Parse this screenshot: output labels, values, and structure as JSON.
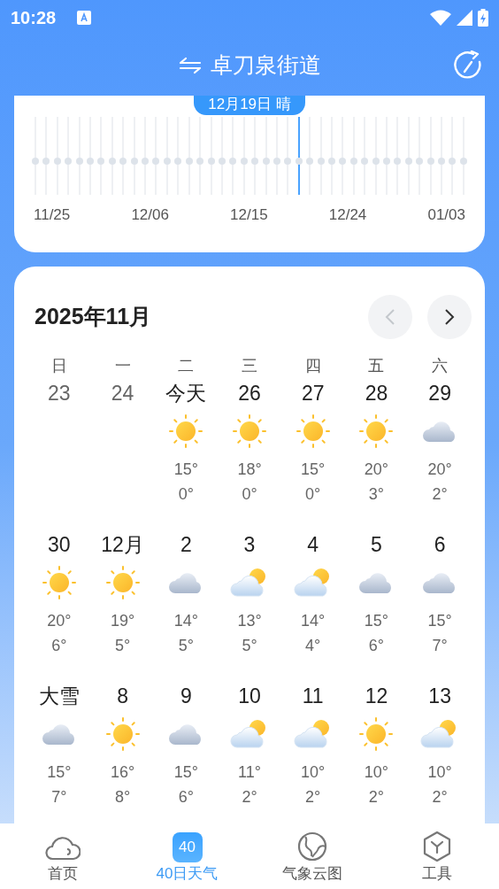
{
  "status_bar": {
    "time": "10:28"
  },
  "header": {
    "title": "卓刀泉街道"
  },
  "timeline": {
    "badge": "12月19日 晴",
    "days": [
      {
        "selected": false
      },
      {
        "selected": false
      },
      {
        "selected": false
      },
      {
        "selected": false
      },
      {
        "selected": false
      },
      {
        "selected": false
      },
      {
        "selected": false
      },
      {
        "selected": false
      },
      {
        "selected": false
      },
      {
        "selected": false
      },
      {
        "selected": false
      },
      {
        "selected": false
      },
      {
        "selected": false
      },
      {
        "selected": false
      },
      {
        "selected": false
      },
      {
        "selected": false
      },
      {
        "selected": false
      },
      {
        "selected": false
      },
      {
        "selected": false
      },
      {
        "selected": false
      },
      {
        "selected": false
      },
      {
        "selected": false
      },
      {
        "selected": false
      },
      {
        "selected": false
      },
      {
        "selected": true
      },
      {
        "selected": false
      },
      {
        "selected": false
      },
      {
        "selected": false
      },
      {
        "selected": false
      },
      {
        "selected": false
      },
      {
        "selected": false
      },
      {
        "selected": false
      },
      {
        "selected": false
      },
      {
        "selected": false
      },
      {
        "selected": false
      },
      {
        "selected": false
      },
      {
        "selected": false
      },
      {
        "selected": false
      },
      {
        "selected": false
      },
      {
        "selected": false
      }
    ],
    "labels": [
      "11/25",
      "12/06",
      "12/15",
      "12/24",
      "01/03"
    ]
  },
  "calendar": {
    "title": "2025年11月",
    "prev_disabled": true,
    "weekdays": [
      "日",
      "一",
      "二",
      "三",
      "四",
      "五",
      "六"
    ],
    "weeks": [
      [
        {
          "label": "23",
          "past": true
        },
        {
          "label": "24",
          "past": true
        },
        {
          "label": "今天",
          "past": false,
          "kind": "sun",
          "high": "15°",
          "low": "0°"
        },
        {
          "label": "26",
          "past": false,
          "kind": "sun",
          "high": "18°",
          "low": "0°"
        },
        {
          "label": "27",
          "past": false,
          "kind": "sun",
          "high": "15°",
          "low": "0°"
        },
        {
          "label": "28",
          "past": false,
          "kind": "sun",
          "high": "20°",
          "low": "3°"
        },
        {
          "label": "29",
          "past": false,
          "kind": "cloud",
          "high": "20°",
          "low": "2°"
        }
      ],
      [
        {
          "label": "30",
          "past": false,
          "kind": "sun",
          "high": "20°",
          "low": "6°"
        },
        {
          "label": "12月",
          "past": false,
          "kind": "sun",
          "high": "19°",
          "low": "5°"
        },
        {
          "label": "2",
          "past": false,
          "kind": "cloud",
          "high": "14°",
          "low": "5°"
        },
        {
          "label": "3",
          "past": false,
          "kind": "partly",
          "high": "13°",
          "low": "5°"
        },
        {
          "label": "4",
          "past": false,
          "kind": "partly",
          "high": "14°",
          "low": "4°"
        },
        {
          "label": "5",
          "past": false,
          "kind": "cloud",
          "high": "15°",
          "low": "6°"
        },
        {
          "label": "6",
          "past": false,
          "kind": "cloud",
          "high": "15°",
          "low": "7°"
        }
      ],
      [
        {
          "label": "大雪",
          "past": false,
          "kind": "cloud",
          "high": "15°",
          "low": "7°"
        },
        {
          "label": "8",
          "past": false,
          "kind": "sun",
          "high": "16°",
          "low": "8°"
        },
        {
          "label": "9",
          "past": false,
          "kind": "cloud",
          "high": "15°",
          "low": "6°"
        },
        {
          "label": "10",
          "past": false,
          "kind": "partly",
          "high": "11°",
          "low": "2°"
        },
        {
          "label": "11",
          "past": false,
          "kind": "partly",
          "high": "10°",
          "low": "2°"
        },
        {
          "label": "12",
          "past": false,
          "kind": "sun",
          "high": "10°",
          "low": "2°"
        },
        {
          "label": "13",
          "past": false,
          "kind": "partly",
          "high": "10°",
          "low": "2°"
        }
      ]
    ]
  },
  "bottom_nav": [
    {
      "label": "首页",
      "kind": "home",
      "selected": false
    },
    {
      "label": "40日天气",
      "kind": "forecast",
      "badge": "40",
      "selected": true
    },
    {
      "label": "气象云图",
      "kind": "map",
      "selected": false
    },
    {
      "label": "工具",
      "kind": "tools",
      "selected": false
    }
  ]
}
